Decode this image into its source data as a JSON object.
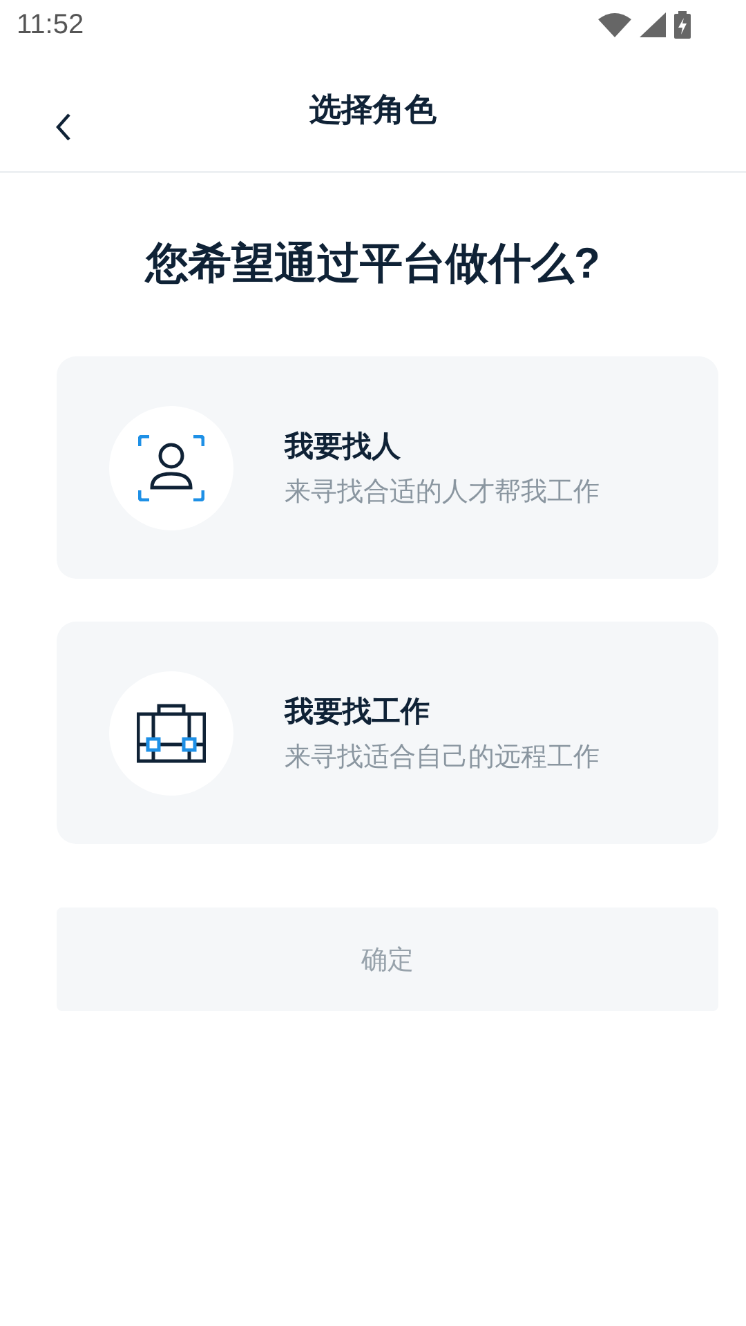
{
  "status_bar": {
    "time": "11:52"
  },
  "header": {
    "title": "选择角色"
  },
  "question": "您希望通过平台做什么?",
  "options": [
    {
      "title": "我要找人",
      "subtitle": "来寻找合适的人才帮我工作",
      "selected": false
    },
    {
      "title": "我要找工作",
      "subtitle": "来寻找适合自己的远程工作",
      "selected": false
    }
  ],
  "confirm_button": {
    "label": "确定",
    "disabled": true
  }
}
